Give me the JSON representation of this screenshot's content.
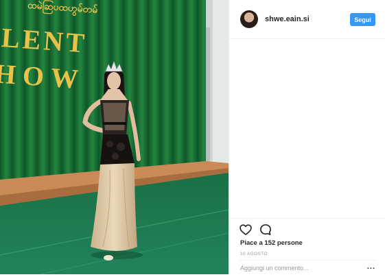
{
  "post": {
    "username": "shwe.eain.si",
    "follow_label": "Segui",
    "likes_text": "Piace a 152 persone",
    "date": "10 AGOSTO",
    "comment_placeholder": "Aggiungi un commento...",
    "more_label": "..."
  },
  "photo": {
    "banner_top_text": "ထမဲဆြပထဟွမ်တမ်",
    "banner_line1": "LENT",
    "banner_line2": "HOW",
    "icon": "photo"
  },
  "icons": {
    "like": "heart-outline-icon",
    "comment": "speech-bubble-icon",
    "more": "ellipsis-icon"
  },
  "colors": {
    "follow_button": "#3897f0",
    "curtain": "#1f7a3a",
    "floor": "#1d7a4a",
    "banner_letters": "#e6c24a",
    "gown": "#d9c6a5"
  }
}
